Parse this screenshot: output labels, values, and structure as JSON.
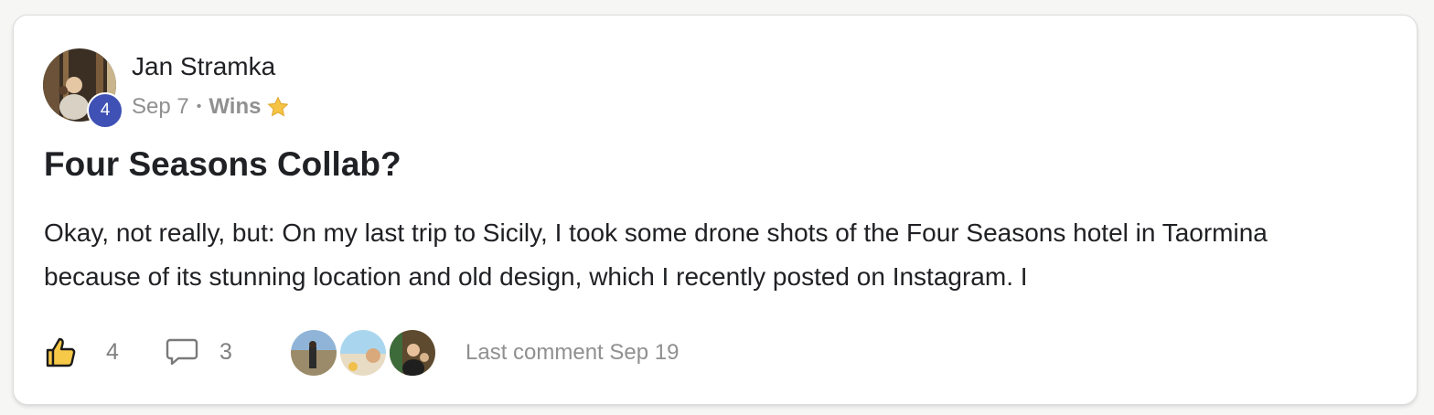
{
  "post": {
    "author": "Jan Stramka",
    "level": "4",
    "date": "Sep 7",
    "separator": "•",
    "category": "Wins",
    "category_icon": "star-icon",
    "title": "Four Seasons Collab?",
    "body": "Okay, not really, but: On my last trip to Sicily, I took some drone shots of the Four Seasons hotel in Taormina because of its stunning location and old design, which I recently posted on Instagram. I"
  },
  "footer": {
    "like_icon": "thumbs-up-icon",
    "like_count": "4",
    "comment_icon": "comment-bubble-icon",
    "comment_count": "3",
    "commenters": [
      "commenter-avatar-1",
      "commenter-avatar-2",
      "commenter-avatar-3"
    ],
    "last_comment": "Last comment Sep 19"
  },
  "colors": {
    "badge": "#3f51b5",
    "text": "#202124",
    "muted": "#909090",
    "star": "#f6c445"
  }
}
